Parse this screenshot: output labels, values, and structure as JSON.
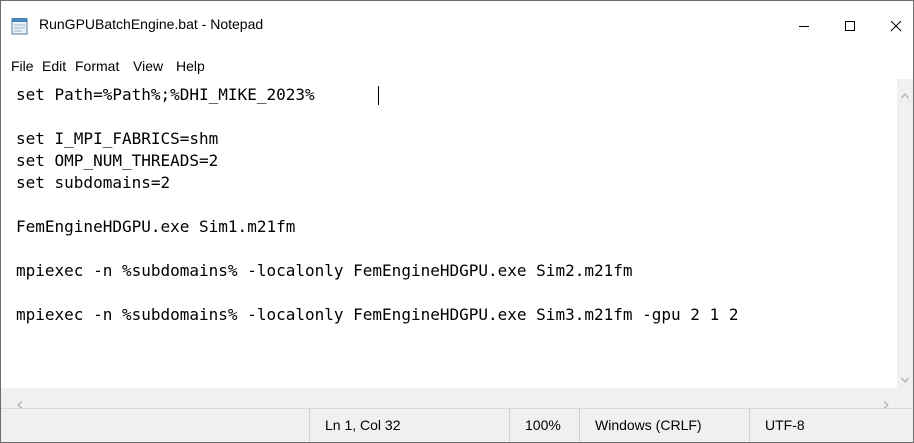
{
  "window": {
    "title": "RunGPUBatchEngine.bat - Notepad",
    "icon": "notepad-icon",
    "controls": {
      "minimize": "minimize-icon",
      "maximize": "maximize-icon",
      "close": "close-icon"
    }
  },
  "menu": [
    {
      "label": "File"
    },
    {
      "label": "Edit"
    },
    {
      "label": "Format"
    },
    {
      "label": "View"
    },
    {
      "label": "Help"
    }
  ],
  "editor": {
    "content": "set Path=%Path%;%DHI_MIKE_2023%\n\nset I_MPI_FABRICS=shm\nset OMP_NUM_THREADS=2\nset subdomains=2\n\nFemEngineHDGPU.exe Sim1.m21fm\n\nmpiexec -n %subdomains% -localonly FemEngineHDGPU.exe Sim2.m21fm\n\nmpiexec -n %subdomains% -localonly FemEngineHDGPU.exe Sim3.m21fm -gpu 2 1 2"
  },
  "statusbar": {
    "position": "Ln 1, Col 32",
    "zoom": "100%",
    "line_ending": "Windows (CRLF)",
    "encoding": "UTF-8"
  }
}
